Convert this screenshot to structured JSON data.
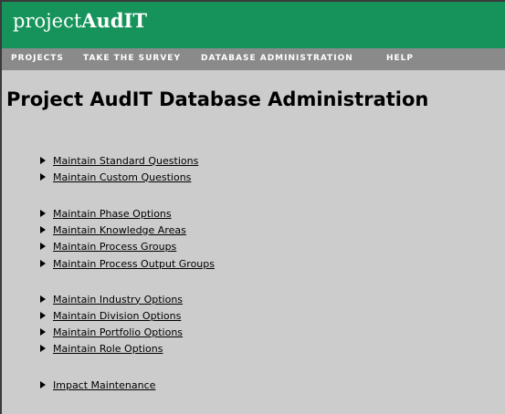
{
  "header": {
    "logo_prefix": "project",
    "logo_bold": "AudIT",
    "colors": {
      "banner": "#15935a",
      "navbar": "#8a8a8a",
      "background": "#cccccc"
    }
  },
  "nav": {
    "items": [
      {
        "label": "PROJECTS"
      },
      {
        "label": "TAKE THE SURVEY"
      },
      {
        "label": "DATABASE ADMINISTRATION"
      },
      {
        "label": "HELP"
      }
    ]
  },
  "main": {
    "title": "Project AudIT Database Administration",
    "link_icon": "arrow-right-icon",
    "links": [
      {
        "label": "Maintain Standard Questions"
      },
      {
        "label": "Maintain Custom Questions"
      },
      {
        "label": "Maintain Phase Options"
      },
      {
        "label": "Maintain Knowledge Areas"
      },
      {
        "label": "Maintain Process Groups"
      },
      {
        "label": "Maintain Process Output Groups"
      },
      {
        "label": "Maintain Industry Options"
      },
      {
        "label": "Maintain Division Options"
      },
      {
        "label": "Maintain Portfolio Options"
      },
      {
        "label": "Maintain Role Options"
      },
      {
        "label": "Impact Maintenance"
      }
    ]
  }
}
